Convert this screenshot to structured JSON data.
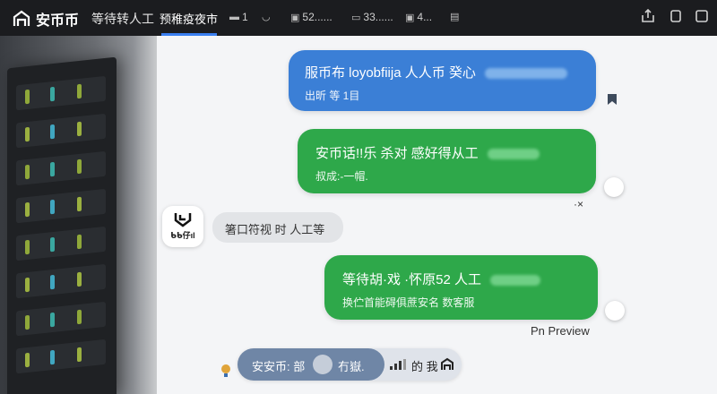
{
  "topbar": {
    "brand": "安币币",
    "status": "等待转人工",
    "active_tab": "预稚疫夜市",
    "items": [
      {
        "icon": "card-icon",
        "label": "1"
      },
      {
        "icon": "shield-icon",
        "label": ""
      },
      {
        "icon": "image-icon",
        "label": "52......"
      },
      {
        "icon": "chat-icon",
        "label": "33......"
      },
      {
        "icon": "image-icon",
        "label": "4..."
      },
      {
        "icon": "doc-icon",
        "label": ""
      }
    ],
    "window_icons": [
      "share-icon",
      "copy-icon",
      "close-icon"
    ]
  },
  "messages": [
    {
      "type": "blue",
      "line1": "服币布 loyobfiija 人人币 癸心",
      "line2": "出昕 等 1目"
    },
    {
      "type": "green",
      "line1": "安币话!!乐 杀对 感好得从工",
      "line2": "叔成:-一帽."
    },
    {
      "type": "agent",
      "avatar_text": "ᑲᑲ仔ıl",
      "text": "箸口符视 时 人工等"
    },
    {
      "type": "green",
      "line1": "等待胡·戏 ·怀原52 人工",
      "line2": "换伫首能碍俱蔗安名 数客服"
    }
  ],
  "small_x": "·×",
  "preview_label": "Pn Preview",
  "input": {
    "left_text": "安安币: 部",
    "middle_text": "冇嶽.",
    "right_text": "的 我",
    "signal_icon": "signal-icon"
  },
  "colors": {
    "blue_bubble": "#3b7fd6",
    "green_bubble": "#2ea84a",
    "topbar": "#1b1c1f",
    "accent": "#3a7ff0"
  }
}
